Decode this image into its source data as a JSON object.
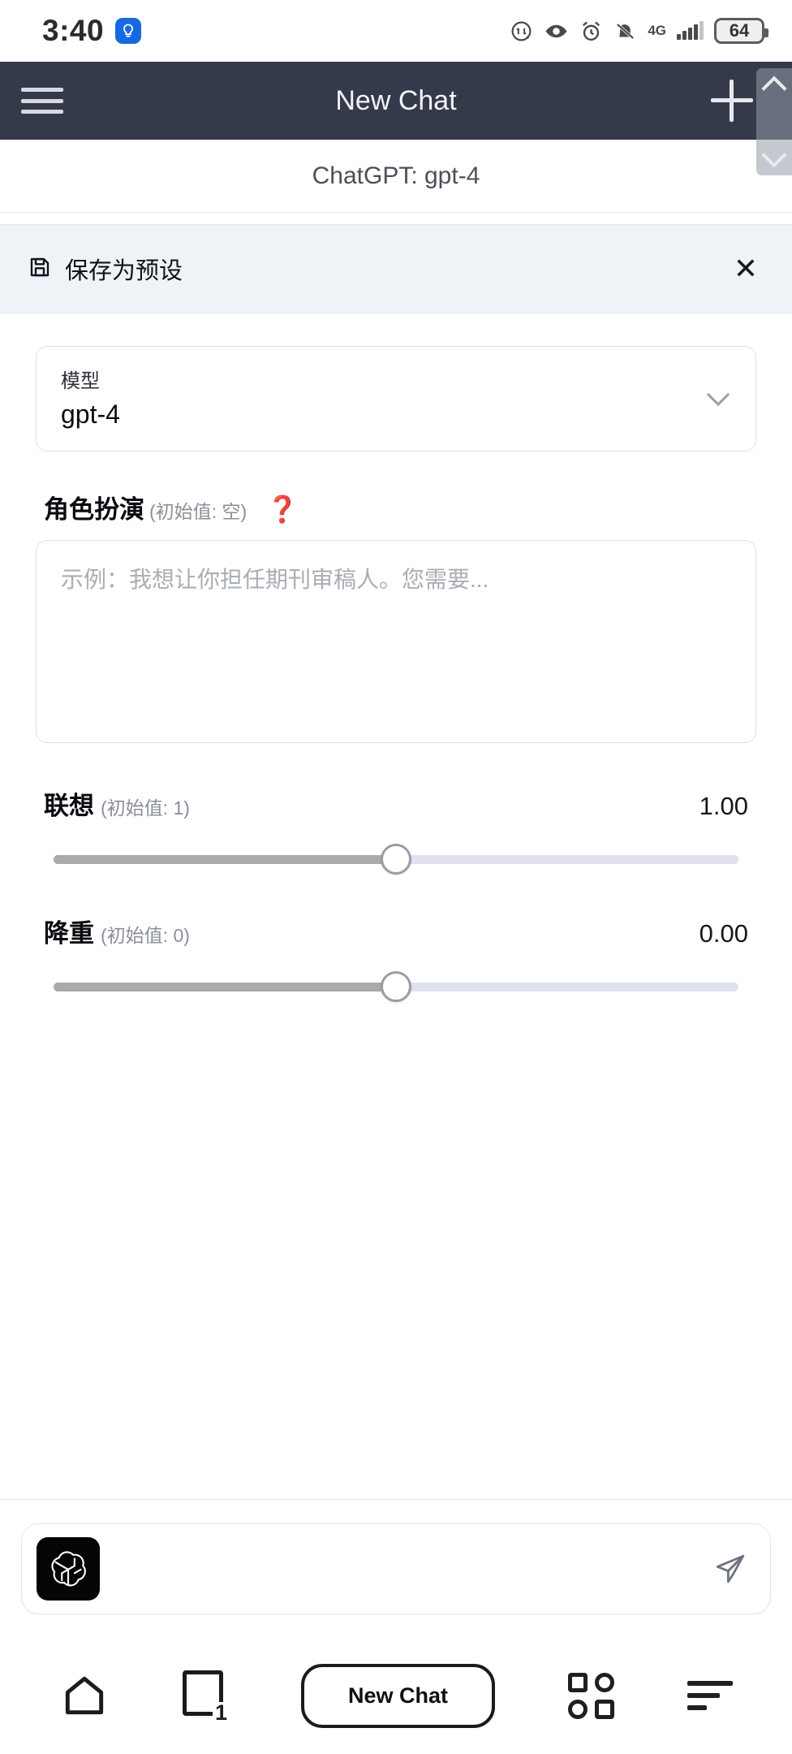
{
  "status_bar": {
    "time": "3:40",
    "app_badge_icon": "lightbulb-icon",
    "icons": [
      "data-saver-icon",
      "eye-comfort-icon",
      "alarm-icon",
      "mute-bell-icon"
    ],
    "network_label": "4G",
    "battery_level": "64"
  },
  "header": {
    "menu_icon": "hamburger-menu-icon",
    "title": "New Chat",
    "add_icon": "plus-icon",
    "scroll_overlay": {
      "up_icon": "chevron-up-icon",
      "down_icon": "chevron-down-icon"
    }
  },
  "subtitle": "ChatGPT: gpt-4",
  "preset_bar": {
    "save_icon": "floppy-disk-save-icon",
    "label": "保存为预设",
    "close_icon": "close-x-icon"
  },
  "model_select": {
    "caption": "模型",
    "value": "gpt-4",
    "chevron_icon": "chevron-down-icon"
  },
  "role_play": {
    "label": "角色扮演",
    "default_note": "(初始值: 空)",
    "help_icon": "red-question-mark-icon",
    "placeholder": "示例：我想让你担任期刊审稿人。您需要...",
    "value": ""
  },
  "sliders": [
    {
      "label": "联想",
      "default_note": "(初始值: 1)",
      "value": "1.00",
      "percent": 50
    },
    {
      "label": "降重",
      "default_note": "(初始值: 0)",
      "value": "0.00",
      "percent": 50
    }
  ],
  "composer": {
    "avatar_icon": "openai-logo-icon",
    "placeholder": "",
    "send_icon": "send-paper-plane-icon"
  },
  "bottom_nav": {
    "home_icon": "home-icon",
    "tabs_icon": "tabs-icon",
    "tabs_count": "1",
    "new_chat_label": "New Chat",
    "apps_icon": "apps-grid-icon",
    "menu_icon": "sort-lines-icon"
  },
  "colors": {
    "header_bg": "#353a4a",
    "preset_bar_bg": "#eff2f7",
    "accent_red": "#d8242a",
    "badge_blue": "#1769e0"
  }
}
